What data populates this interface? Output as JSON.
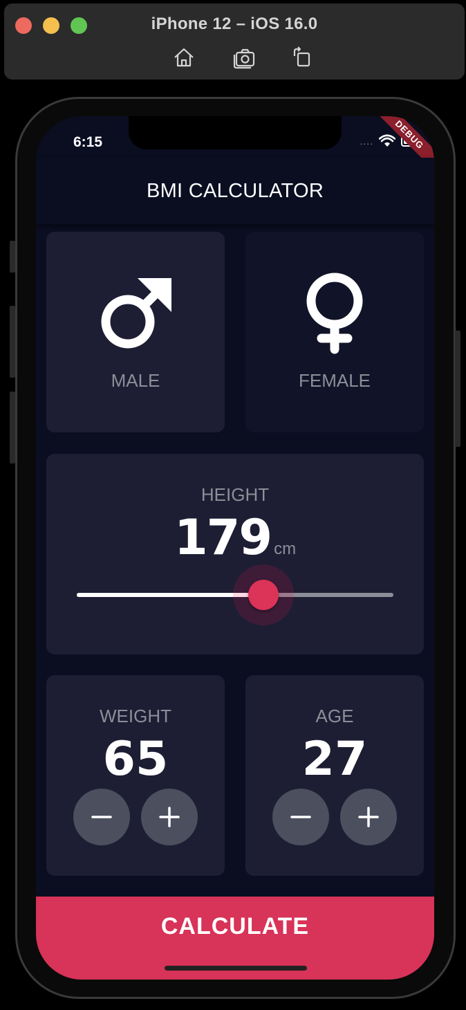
{
  "simulator": {
    "title": "iPhone 12 – iOS 16.0",
    "toolbar_icons": [
      "home-icon",
      "screenshot-icon",
      "rotate-icon"
    ]
  },
  "status_bar": {
    "time": "6:15",
    "signal": "....",
    "debug_banner": "DEBUG"
  },
  "app_bar": {
    "title": "BMI CALCULATOR"
  },
  "gender": {
    "male": {
      "label": "MALE",
      "icon": "mars-icon",
      "selected": true
    },
    "female": {
      "label": "FEMALE",
      "icon": "venus-icon",
      "selected": false
    }
  },
  "height": {
    "label": "HEIGHT",
    "value": "179",
    "unit": "cm",
    "slider_fraction": 0.59
  },
  "weight": {
    "label": "WEIGHT",
    "value": "65",
    "minus_icon": "minus-icon",
    "plus_icon": "plus-icon"
  },
  "age": {
    "label": "AGE",
    "value": "27",
    "minus_icon": "minus-icon",
    "plus_icon": "plus-icon"
  },
  "calculate_button": {
    "label": "CALCULATE"
  },
  "colors": {
    "background": "#0b0e21",
    "card_active": "#1d1e33",
    "card_inactive": "#111328",
    "accent": "#d83358",
    "label_gray": "#8d8e98",
    "round_button": "#4c4f5e"
  }
}
